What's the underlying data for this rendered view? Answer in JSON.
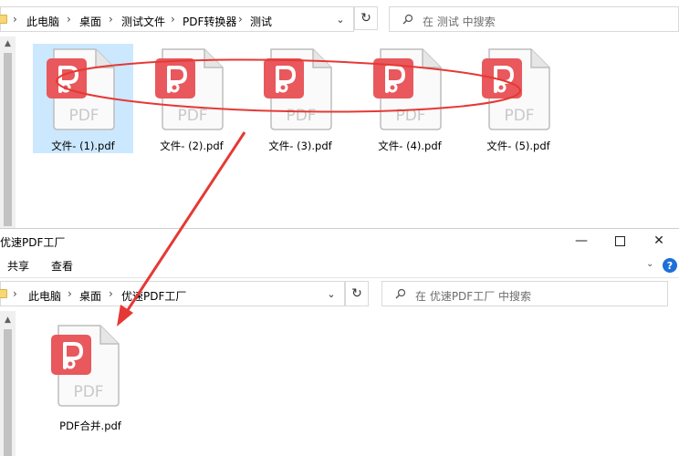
{
  "top_window": {
    "breadcrumb": [
      "此电脑",
      "桌面",
      "测试文件",
      "PDF转换器",
      "测试"
    ],
    "search_placeholder": "在 测试 中搜索",
    "files": [
      {
        "name": "文件- (1).pdf",
        "selected": true
      },
      {
        "name": "文件- (2).pdf",
        "selected": false
      },
      {
        "name": "文件- (3).pdf",
        "selected": false
      },
      {
        "name": "文件- (4).pdf",
        "selected": false
      },
      {
        "name": "文件- (5).pdf",
        "selected": false
      }
    ]
  },
  "second_window": {
    "title": "优速PDF工厂",
    "ribbon_tabs": [
      "共享",
      "查看"
    ],
    "breadcrumb": [
      "此电脑",
      "桌面",
      "优速PDF工厂"
    ],
    "search_placeholder": "在 优速PDF工厂 中搜索",
    "files": [
      {
        "name": "PDF合并.pdf"
      }
    ]
  },
  "file_icon_label": "PDF",
  "colors": {
    "pdf_badge": "#e8585c",
    "annotation_red": "#e53935",
    "selection": "#cce8ff",
    "help_blue": "#1e6fd9"
  }
}
